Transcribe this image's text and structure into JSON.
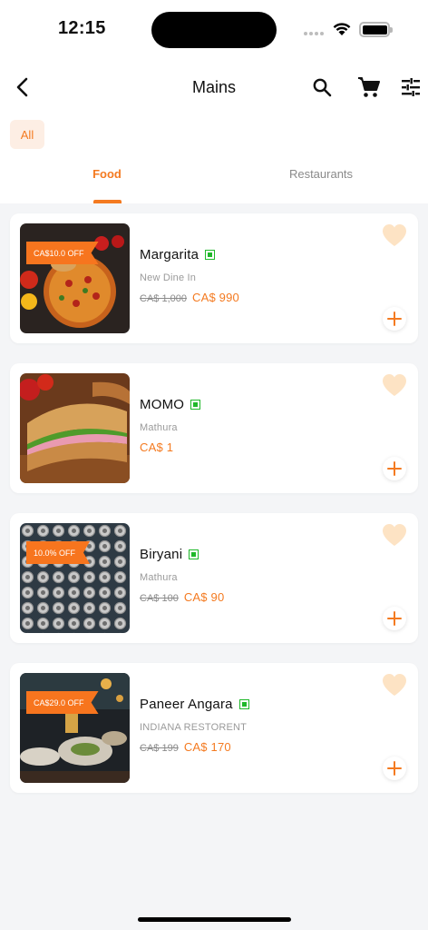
{
  "status_bar": {
    "time": "12:15"
  },
  "header": {
    "title": "Mains",
    "back_icon": "chevron-left-icon",
    "search_icon": "search-icon",
    "cart_icon": "cart-icon",
    "filter_icon": "tune-icon"
  },
  "filter_chip": {
    "label": "All"
  },
  "tabs": [
    {
      "label": "Food",
      "active": true
    },
    {
      "label": "Restaurants",
      "active": false
    }
  ],
  "colors": {
    "accent": "#f47a20",
    "veg": "#1fb82a",
    "heart": "#fde3c4"
  },
  "items": [
    {
      "name": "Margarita",
      "restaurant": "New Dine In",
      "old_price": "CA$ 1,000",
      "price": "CA$ 990",
      "offer": "CA$10.0 OFF",
      "veg": true
    },
    {
      "name": "MOMO",
      "restaurant": "Mathura",
      "old_price": "",
      "price": "CA$ 1",
      "offer": "",
      "veg": true
    },
    {
      "name": "Biryani",
      "restaurant": "Mathura",
      "old_price": "CA$ 100",
      "price": "CA$ 90",
      "offer": "10.0% OFF",
      "veg": true
    },
    {
      "name": "Paneer Angara",
      "restaurant": "INDIANA RESTORENT",
      "old_price": "CA$ 199",
      "price": "CA$ 170",
      "offer": "CA$29.0 OFF",
      "veg": true
    }
  ]
}
